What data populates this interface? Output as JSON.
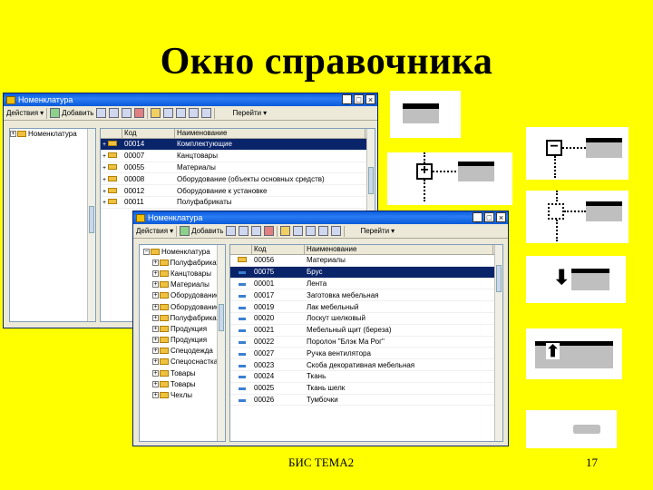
{
  "slide": {
    "title": "Окно справочника",
    "footer_left": "БИС ТЕМА2",
    "footer_right": "17"
  },
  "back_window": {
    "title": "Номенклатура",
    "toolbar": {
      "actions": "Действия",
      "add": "Добавить",
      "goto": "Перейти"
    },
    "tree_root": "Номенклатура",
    "columns": [
      "Код",
      "Наименование"
    ],
    "rows": [
      {
        "code": "00014",
        "name": "Комплектующие"
      },
      {
        "code": "00007",
        "name": "Канцтовары"
      },
      {
        "code": "00055",
        "name": "Материалы"
      },
      {
        "code": "00008",
        "name": "Оборудование (объекты основных средств)"
      },
      {
        "code": "00012",
        "name": "Оборудование к установке"
      },
      {
        "code": "00011",
        "name": "Полуфабрикаты"
      }
    ]
  },
  "front_window": {
    "title": "Номенклатура",
    "toolbar": {
      "actions": "Действия",
      "add": "Добавить",
      "goto": "Перейти"
    },
    "tree": [
      "Номенклатура",
      "Полуфабрикаты",
      "Канцтовары",
      "Материалы",
      "Оборудование",
      "Оборудование",
      "Полуфабрикаты",
      "Продукция",
      "Продукция",
      "Спецодежда",
      "Спецоснастка",
      "Товары",
      "Товары",
      "Чехлы"
    ],
    "columns": [
      "Код",
      "Наименование"
    ],
    "rows": [
      {
        "code": "00056",
        "name": "Материалы",
        "type": "folder",
        "selected": false
      },
      {
        "code": "00075",
        "name": "Брус",
        "type": "item",
        "selected": true
      },
      {
        "code": "00001",
        "name": "Лента",
        "type": "item",
        "selected": false
      },
      {
        "code": "00017",
        "name": "Заготовка мебельная",
        "type": "item",
        "selected": false
      },
      {
        "code": "00019",
        "name": "Лак мебельный",
        "type": "item",
        "selected": false
      },
      {
        "code": "00020",
        "name": "Лоскут шелковый",
        "type": "item",
        "selected": false
      },
      {
        "code": "00021",
        "name": "Мебельный щит (береза)",
        "type": "item",
        "selected": false
      },
      {
        "code": "00022",
        "name": "Поролон \"Блэк Ма Рог\"",
        "type": "item",
        "selected": false
      },
      {
        "code": "00027",
        "name": "Ручка вентилятора",
        "type": "item",
        "selected": false
      },
      {
        "code": "00023",
        "name": "Скоба декоративная мебельная",
        "type": "item",
        "selected": false
      },
      {
        "code": "00024",
        "name": "Ткань",
        "type": "item",
        "selected": false
      },
      {
        "code": "00025",
        "name": "Ткань шелк",
        "type": "item",
        "selected": false
      },
      {
        "code": "00026",
        "name": "Тумбочки",
        "type": "item",
        "selected": false
      }
    ]
  }
}
